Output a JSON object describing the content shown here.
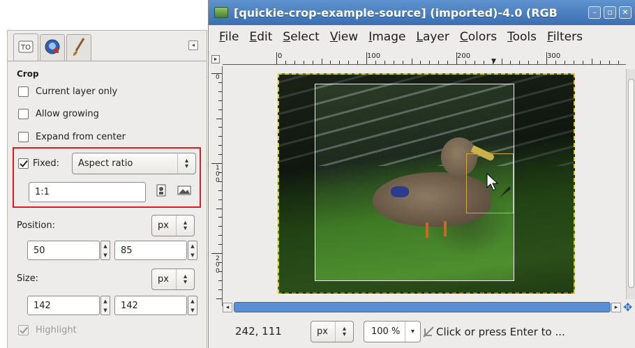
{
  "tool_options": {
    "tabs": [
      {
        "name": "tool-options",
        "icon": "tool-options-icon"
      },
      {
        "name": "device-status",
        "icon": "device-status-icon"
      },
      {
        "name": "brushes",
        "icon": "paintbrush-icon"
      }
    ],
    "section_title": "Crop",
    "current_layer_only": {
      "label": "Current layer only",
      "checked": false
    },
    "allow_growing": {
      "label": "Allow growing",
      "checked": false
    },
    "expand_from_center": {
      "label": "Expand from center",
      "checked": false
    },
    "fixed": {
      "label": "Fixed:",
      "checked": true,
      "mode": "Aspect ratio"
    },
    "ratio_value": "1:1",
    "position": {
      "label": "Position:",
      "unit": "px",
      "x": "50",
      "y": "85"
    },
    "size": {
      "label": "Size:",
      "unit": "px",
      "w": "142",
      "h": "142"
    },
    "highlight": {
      "label": "Highlight",
      "checked": true,
      "disabled": true
    }
  },
  "image_window": {
    "title": "[quickie-crop-example-source] (imported)-4.0 (RGB",
    "menu": [
      {
        "label": "File",
        "u": "F",
        "rest": "ile"
      },
      {
        "label": "Edit",
        "u": "E",
        "rest": "dit"
      },
      {
        "label": "Select",
        "u": "S",
        "rest": "elect"
      },
      {
        "label": "View",
        "u": "V",
        "rest": "iew"
      },
      {
        "label": "Image",
        "u": "I",
        "rest": "mage"
      },
      {
        "label": "Layer",
        "u": "L",
        "rest": "ayer"
      },
      {
        "label": "Colors",
        "u": "C",
        "rest": "olors"
      },
      {
        "label": "Tools",
        "u": "T",
        "rest": "ools"
      },
      {
        "label": "Filters",
        "u": "F",
        "rest": "ilters"
      }
    ],
    "ruler_h_labels": [
      "0",
      "100",
      "200",
      "300"
    ],
    "ruler_v_labels": [
      "0",
      "100",
      "200"
    ],
    "status": {
      "coords": "242, 111",
      "unit": "px",
      "zoom": "100 %",
      "message": "Click or press Enter to ..."
    }
  },
  "colors": {
    "highlight_box": "#e11b1b",
    "titlebar": "#3a6fb1",
    "marching_ants": "#e8d000"
  }
}
